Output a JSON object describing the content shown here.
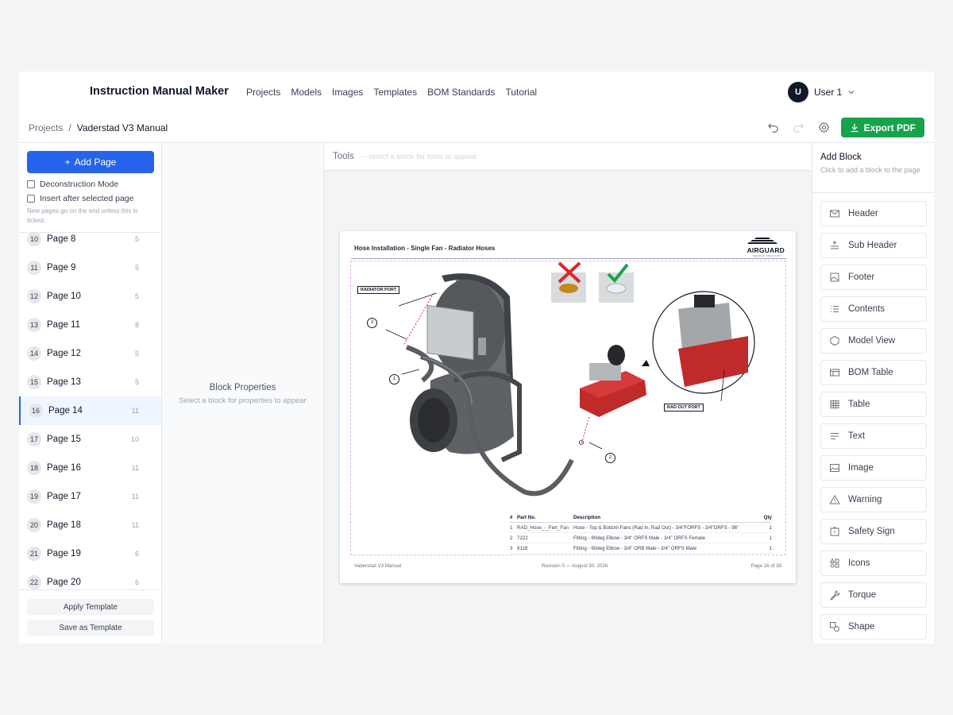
{
  "app": {
    "title": "Instruction Manual Maker",
    "nav": [
      "Projects",
      "Models",
      "Images",
      "Templates",
      "BOM Standards",
      "Tutorial"
    ],
    "user": {
      "initial": "U",
      "name": "User 1"
    }
  },
  "breadcrumb": {
    "root": "Projects",
    "separator": "/",
    "current": "Vaderstad V3 Manual"
  },
  "toolbar": {
    "export_label": "Export PDF",
    "export_color": "#16a34a"
  },
  "left": {
    "add_page": "Add Page",
    "deconstruction": "Deconstruction Mode",
    "insert_after": "Insert after selected page",
    "hint": "New pages go on the end unless this is ticked.",
    "pages": [
      {
        "num": "10",
        "name": "Page 8",
        "count": "5"
      },
      {
        "num": "11",
        "name": "Page 9",
        "count": "5"
      },
      {
        "num": "12",
        "name": "Page 10",
        "count": "5"
      },
      {
        "num": "13",
        "name": "Page 11",
        "count": "8"
      },
      {
        "num": "14",
        "name": "Page 12",
        "count": "5"
      },
      {
        "num": "15",
        "name": "Page 13",
        "count": "5"
      },
      {
        "num": "16",
        "name": "Page 14",
        "count": "11",
        "selected": true
      },
      {
        "num": "17",
        "name": "Page 15",
        "count": "10"
      },
      {
        "num": "18",
        "name": "Page 16",
        "count": "11"
      },
      {
        "num": "19",
        "name": "Page 17",
        "count": "11"
      },
      {
        "num": "20",
        "name": "Page 18",
        "count": "11"
      },
      {
        "num": "21",
        "name": "Page 19",
        "count": "6"
      },
      {
        "num": "22",
        "name": "Page 20",
        "count": "6"
      }
    ],
    "apply_template": "Apply Template",
    "save_template": "Save as Template"
  },
  "props": {
    "title": "Block Properties",
    "subtitle": "Select a block for properties to appear"
  },
  "tools": {
    "label": "Tools",
    "hint": "— select a block for tools to appear"
  },
  "sheet": {
    "title": "Hose Installation - Single Fan - Radiator Hoses",
    "logo": "AIRGUARD",
    "logo_sub": "SEEDING PRECISION",
    "callouts": {
      "radiator_port": "RADIATOR PORT",
      "rad_out_port": "RAD OUT PORT",
      "n1": "1",
      "n2": "2",
      "n3": "3"
    },
    "bom": {
      "headers": [
        "#",
        "Part No.",
        "Description",
        "Qty"
      ],
      "rows": [
        [
          "1",
          "RAD_Hose_-_Fert_Fan",
          "Hose - Top & Bottom Fans (Rad In, Rad Out) - 3/4\"FORFS - 3/4\"ORFS - 96\"",
          "1"
        ],
        [
          "2",
          "7222",
          "Fitting - 90deg Elbow - 3/4\" ORFS Male - 3/4\" ORFS Female",
          "1"
        ],
        [
          "3",
          "9118",
          "Fitting - 90deg Elbow - 3/4\" ORB Male - 3/4\" ORFS Male",
          "1"
        ]
      ]
    },
    "footer": {
      "left": "Vaderstad V3 Manual",
      "center": "Revision 0 — August 30, 2026",
      "right": "Page 16 of 39"
    }
  },
  "right": {
    "title": "Add Block",
    "subtitle": "Click to add a block to the page",
    "blocks": [
      {
        "label": "Header",
        "icon": "mail-icon"
      },
      {
        "label": "Sub Header",
        "icon": "align-icon"
      },
      {
        "label": "Footer",
        "icon": "image-frame-icon"
      },
      {
        "label": "Contents",
        "icon": "list-icon"
      },
      {
        "label": "Model View",
        "icon": "hexagon-icon"
      },
      {
        "label": "BOM Table",
        "icon": "bom-table-icon"
      },
      {
        "label": "Table",
        "icon": "grid-icon"
      },
      {
        "label": "Text",
        "icon": "text-lines-icon"
      },
      {
        "label": "Image",
        "icon": "image-icon"
      },
      {
        "label": "Warning",
        "icon": "warning-triangle-icon"
      },
      {
        "label": "Safety Sign",
        "icon": "sign-icon"
      },
      {
        "label": "Icons",
        "icon": "shapes-icon"
      },
      {
        "label": "Torque",
        "icon": "wrench-icon"
      },
      {
        "label": "Shape",
        "icon": "shape-icon"
      }
    ]
  },
  "colors": {
    "accent": "#2563eb",
    "export": "#16a34a",
    "error": "#dc2626",
    "ok": "#16a34a",
    "manifold_red": "#c02a2a"
  }
}
